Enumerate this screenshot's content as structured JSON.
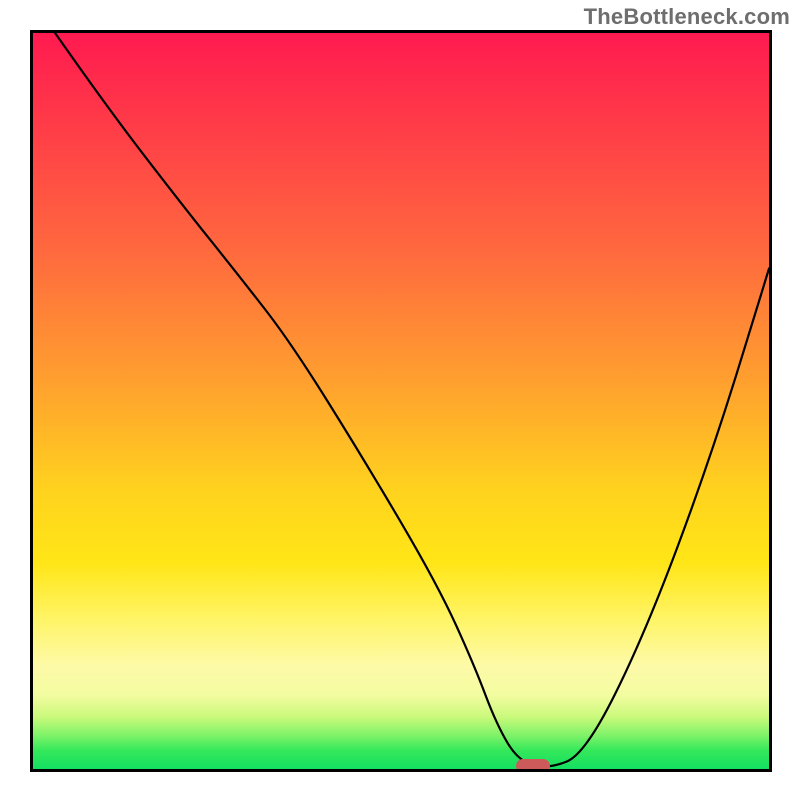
{
  "watermark": "TheBottleneck.com",
  "chart_data": {
    "type": "line",
    "title": "",
    "xlabel": "",
    "ylabel": "",
    "xlim": [
      0,
      100
    ],
    "ylim": [
      0,
      100
    ],
    "grid": false,
    "legend": false,
    "series": [
      {
        "name": "bottleneck-curve",
        "x": [
          3,
          10,
          20,
          28,
          35,
          45,
          55,
          60,
          63,
          66,
          70,
          75,
          83,
          92,
          100
        ],
        "y": [
          100,
          90,
          77,
          67,
          58,
          42,
          25,
          14,
          6,
          1,
          0,
          2,
          18,
          42,
          68
        ],
        "color": "#000000"
      }
    ],
    "annotations": [
      {
        "name": "optimal-marker",
        "x": 68,
        "y": 0,
        "color": "#cc5a5a"
      }
    ],
    "background_gradient": {
      "top": "#ff1a50",
      "mid": "#ffd21e",
      "bottom": "#14df62"
    }
  }
}
